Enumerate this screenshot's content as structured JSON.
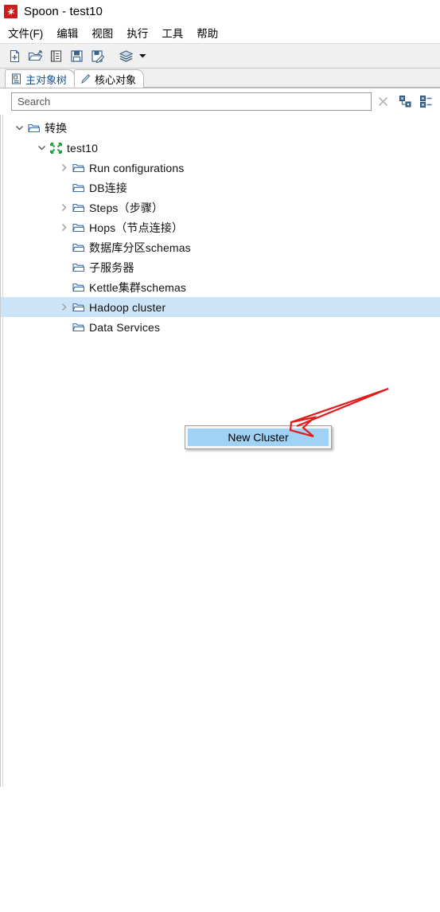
{
  "window": {
    "title": "Spoon - test10",
    "app_icon": "spoon-icon",
    "icon_color": "#cf1b1b"
  },
  "menubar": {
    "items": [
      {
        "label": "文件(F)",
        "name": "menu-file"
      },
      {
        "label": "编辑",
        "name": "menu-edit"
      },
      {
        "label": "视图",
        "name": "menu-view"
      },
      {
        "label": "执行",
        "name": "menu-run"
      },
      {
        "label": "工具",
        "name": "menu-tools"
      },
      {
        "label": "帮助",
        "name": "menu-help"
      }
    ]
  },
  "toolbar": {
    "buttons": [
      {
        "icon": "new-file-icon",
        "name": "new-file-button"
      },
      {
        "icon": "open-folder-icon",
        "name": "open-file-button"
      },
      {
        "icon": "explorer-icon",
        "name": "explorer-button"
      },
      {
        "icon": "save-icon",
        "name": "save-button"
      },
      {
        "icon": "save-as-icon",
        "name": "save-as-button"
      },
      {
        "icon": "layers-icon",
        "name": "perspective-button"
      }
    ],
    "dropdown_icon": "chevron-down-icon"
  },
  "tabs": [
    {
      "label": "主对象树",
      "icon": "document-tree-icon",
      "active": true
    },
    {
      "label": "核心对象",
      "icon": "pencil-icon",
      "active": false
    }
  ],
  "search": {
    "placeholder": "Search",
    "value": "",
    "clear_icon": "close-icon",
    "collapse_all_icon": "collapse-all-icon",
    "expand_all_icon": "expand-all-icon"
  },
  "tree": {
    "rows": [
      {
        "label": "转换",
        "indent": 0,
        "twisty": "expanded",
        "icon": "folder-icon",
        "selected": false
      },
      {
        "label": "test10",
        "indent": 1,
        "twisty": "expanded",
        "icon": "transformation-icon",
        "selected": false
      },
      {
        "label": "Run configurations",
        "indent": 2,
        "twisty": "collapsed",
        "icon": "folder-icon",
        "selected": false
      },
      {
        "label": "DB连接",
        "indent": 2,
        "twisty": "none",
        "icon": "folder-icon",
        "selected": false
      },
      {
        "label": "Steps（步骤）",
        "indent": 2,
        "twisty": "collapsed",
        "icon": "folder-icon",
        "selected": false
      },
      {
        "label": "Hops（节点连接）",
        "indent": 2,
        "twisty": "collapsed",
        "icon": "folder-icon",
        "selected": false
      },
      {
        "label": "数据库分区schemas",
        "indent": 2,
        "twisty": "none",
        "icon": "folder-icon",
        "selected": false
      },
      {
        "label": "子服务器",
        "indent": 2,
        "twisty": "none",
        "icon": "folder-icon",
        "selected": false
      },
      {
        "label": "Kettle集群schemas",
        "indent": 2,
        "twisty": "none",
        "icon": "folder-icon",
        "selected": false
      },
      {
        "label": "Hadoop cluster",
        "indent": 2,
        "twisty": "collapsed",
        "icon": "folder-icon",
        "selected": true
      },
      {
        "label": "Data Services",
        "indent": 2,
        "twisty": "none",
        "icon": "folder-icon",
        "selected": false
      }
    ],
    "selection_color": "#cce4f7"
  },
  "context_menu": {
    "items": [
      {
        "label": "New Cluster",
        "highlighted": true
      }
    ],
    "highlight_color": "#9fd2f4"
  },
  "annotation": {
    "arrow_color": "#e01b1b",
    "type": "pointer-arrow"
  }
}
